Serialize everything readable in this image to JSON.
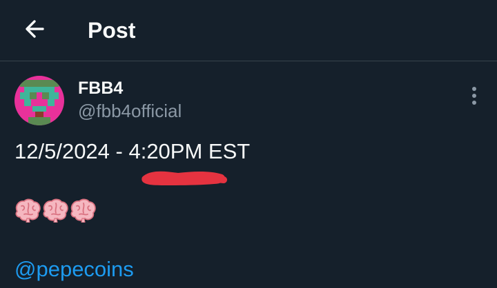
{
  "header": {
    "title": "Post",
    "back_icon": "arrow-left-icon"
  },
  "author": {
    "display_name": "FBB4",
    "handle": "@fbb4official",
    "avatar_icon": "pixel-avatar",
    "avatar_colors": [
      "#e8319a",
      "#5a8a52",
      "#3fb59a",
      "#8a3b2c"
    ]
  },
  "post": {
    "text": "12/5/2024 - 4:20PM EST",
    "emojis": [
      "brain-emoji",
      "brain-emoji",
      "brain-emoji"
    ],
    "mention": "@pepecoins"
  },
  "colors": {
    "background": "#15202b",
    "text": "#f7f9f9",
    "muted": "#8b98a5",
    "accent": "#1d9bf0",
    "redaction": "#e53340"
  }
}
